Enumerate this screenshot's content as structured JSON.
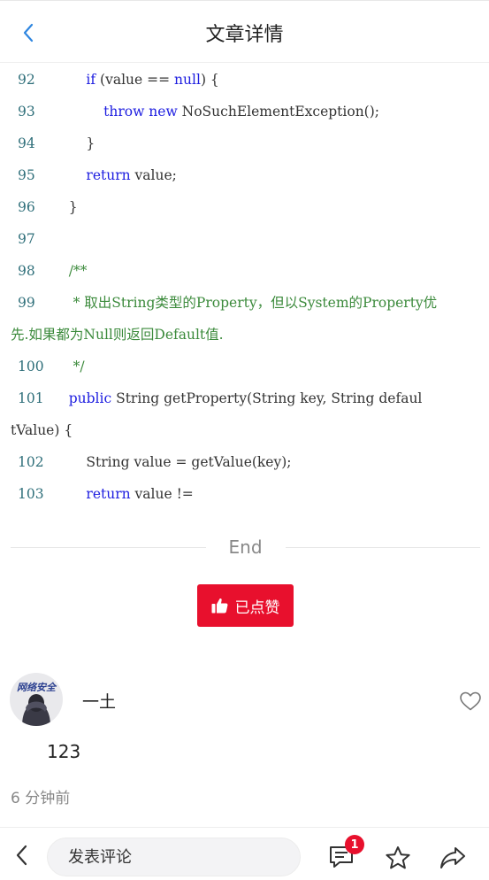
{
  "header": {
    "title": "文章详情"
  },
  "code_lines": [
    {
      "num": "92",
      "parts": [
        {
          "t": "        ",
          "c": "p"
        },
        {
          "t": "if",
          "c": "kw"
        },
        {
          "t": " (value == ",
          "c": "p"
        },
        {
          "t": "null",
          "c": "kw"
        },
        {
          "t": ") {",
          "c": "p"
        }
      ]
    },
    {
      "num": "93",
      "parts": [
        {
          "t": "            ",
          "c": "p"
        },
        {
          "t": "throw",
          "c": "kw"
        },
        {
          "t": " ",
          "c": "p"
        },
        {
          "t": "new",
          "c": "kw"
        },
        {
          "t": " NoSuchElementException();",
          "c": "p"
        }
      ]
    },
    {
      "num": "94",
      "parts": [
        {
          "t": "        }",
          "c": "p"
        }
      ]
    },
    {
      "num": "95",
      "parts": [
        {
          "t": "        ",
          "c": "p"
        },
        {
          "t": "return",
          "c": "kw"
        },
        {
          "t": " value;",
          "c": "p"
        }
      ]
    },
    {
      "num": "96",
      "parts": [
        {
          "t": "    }",
          "c": "p"
        }
      ]
    },
    {
      "num": "97",
      "parts": []
    },
    {
      "num": "98",
      "parts": [
        {
          "t": "    /**",
          "c": "cm"
        }
      ]
    },
    {
      "num": "99",
      "parts": [
        {
          "t": "     * 取出String类型的Property，但以System的Property优",
          "c": "cm"
        }
      ],
      "wrap": [
        {
          "t": "先.如果都为Null则返回Default值.",
          "c": "cm"
        }
      ]
    },
    {
      "num": "100",
      "parts": [
        {
          "t": "     */",
          "c": "cm"
        }
      ]
    },
    {
      "num": "101",
      "parts": [
        {
          "t": "    ",
          "c": "p"
        },
        {
          "t": "public",
          "c": "kw"
        },
        {
          "t": " String getProperty(String key, String defaul",
          "c": "p"
        }
      ],
      "wrap": [
        {
          "t": "tValue) {",
          "c": "p"
        }
      ]
    },
    {
      "num": "102",
      "parts": [
        {
          "t": "        String value = getValue(key);",
          "c": "p"
        }
      ]
    },
    {
      "num": "103",
      "parts": [
        {
          "t": "        ",
          "c": "p"
        },
        {
          "t": "return",
          "c": "kw"
        },
        {
          "t": " value !=",
          "c": "p"
        }
      ]
    }
  ],
  "end_label": "End",
  "like_button": {
    "label": "已点赞",
    "icon": "thumbs-up-icon"
  },
  "comment": {
    "avatar_text": "网络安全",
    "author": "一土",
    "text": "123",
    "time": "6 分钟前"
  },
  "bottom_bar": {
    "input_placeholder": "发表评论",
    "comment_count": "1"
  },
  "colors": {
    "accent": "#e8102d",
    "keyword": "#1d1de0",
    "comment": "#3b8a3b",
    "line_number": "#2f6f7a"
  }
}
